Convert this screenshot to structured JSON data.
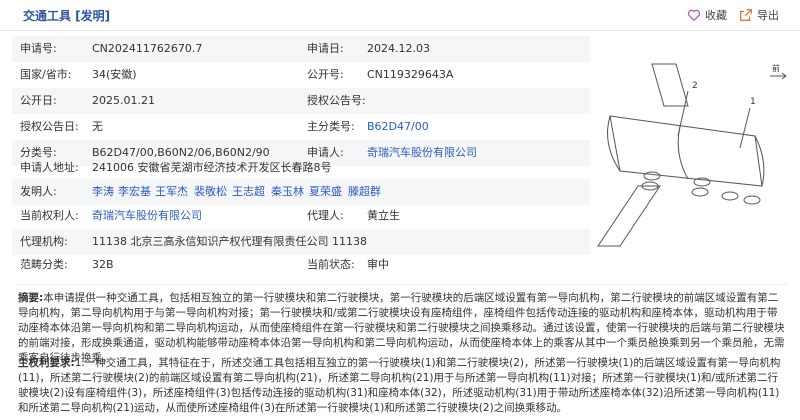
{
  "header": {
    "title": "交通工具 [发明]",
    "favorite_label": "收藏",
    "export_label": "导出"
  },
  "fields": {
    "app_no_label": "申请号:",
    "app_no": "CN202411762670.7",
    "app_date_label": "申请日:",
    "app_date": "2024.12.03",
    "country_label": "国家/省市:",
    "country": "34(安徽)",
    "pub_no_label": "公开号:",
    "pub_no": "CN119329643A",
    "pub_date_label": "公开日:",
    "pub_date": "2025.01.21",
    "grant_pub_no_label": "授权公告号:",
    "grant_pub_no": "",
    "grant_date_label": "授权公告日:",
    "grant_date": "无",
    "main_class_label": "主分类号:",
    "main_class": "B62D47/00",
    "class_label": "分类号:",
    "class": "B62D47/00,B60N2/06,B60N2/90",
    "applicant_label": "申请人:",
    "applicant": "奇瑞汽车股份有限公司",
    "address_label": "申请人地址:",
    "address": "241006 安徽省芜湖市经济技术开发区长春路8号",
    "inventor_label": "发明人:",
    "inventors": [
      "李涛",
      "李宏基",
      "王军杰",
      "裴敬松",
      "王志超",
      "秦玉林",
      "夏荣盛",
      "滕超群"
    ],
    "owner_label": "当前权利人:",
    "owner": "奇瑞汽车股份有限公司",
    "agent_label": "代理人:",
    "agent": "黄立生",
    "agency_label": "代理机构:",
    "agency": "11138 北京三高永信知识产权代理有限责任公司 11138",
    "scope_label": "范畴分类:",
    "scope": "32B",
    "status_label": "当前状态:",
    "status": "审中"
  },
  "figure": {
    "labels": [
      "2",
      "1",
      "前"
    ]
  },
  "abstract": {
    "label": "摘要:",
    "text": "本申请提供一种交通工具，包括相互独立的第一行驶模块和第二行驶模块，第一行驶模块的后端区域设置有第一导向机构，第二行驶模块的前端区域设置有第二导向机构，第二导向机构用于与第一导向机构对接；第一行驶模块和/或第二行驶模块设有座椅组件，座椅组件包括传动连接的驱动机构和座椅本体，驱动机构用于带动座椅本体沿第一导向机构和第二导向机构运动，从而使座椅组件在第一行驶模块和第二行驶模块之间换乘移动。通过该设置，使第一行驶模块的后端与第二行驶模块的前端对接，形成换乘通道，驱动机构能够带动座椅本体沿第一导向机构和第二导向机构运动，从而使座椅本体上的乘客从其中一个乘员舱换乘到另一个乘员舱，无需乘客自行徒步换乘。"
  },
  "claims": {
    "label": "主权利要求:",
    "text": "1.一种交通工具，其特征在于，所述交通工具包括相互独立的第一行驶模块(1)和第二行驶模块(2)，所述第一行驶模块(1)的后端区域设置有第一导向机构(11)，所述第二行驶模块(2)的前端区域设置有第二导向机构(21)，所述第二导向机构(21)用于与所述第一导向机构(11)对接；所述第一行驶模块(1)和/或所述第二行驶模块(2)设有座椅组件(3)，所述座椅组件(3)包括传动连接的驱动机构(31)和座椅本体(32)，所述驱动机构(31)用于带动所述座椅本体(32)沿所述第一导向机构(11)和所述第二导向机构(21)运动，从而使所述座椅组件(3)在所述第一行驶模块(1)和所述第二行驶模块(2)之间换乘移动。"
  }
}
